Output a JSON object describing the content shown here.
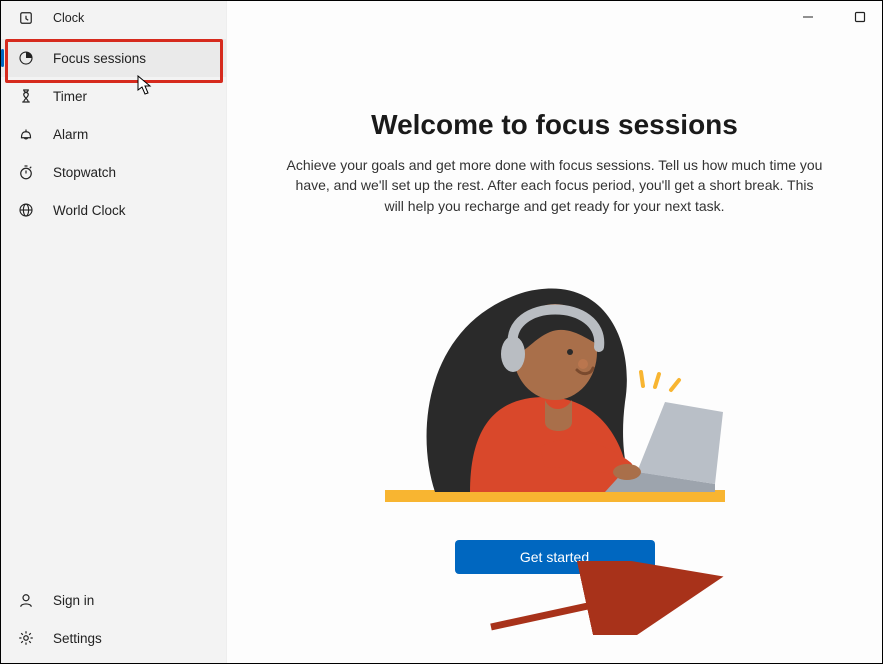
{
  "app": {
    "title": "Clock"
  },
  "sidebar": {
    "items": [
      {
        "label": "Focus sessions"
      },
      {
        "label": "Timer"
      },
      {
        "label": "Alarm"
      },
      {
        "label": "Stopwatch"
      },
      {
        "label": "World Clock"
      }
    ],
    "bottom": {
      "signin": "Sign in",
      "settings": "Settings"
    }
  },
  "main": {
    "headline": "Welcome to focus sessions",
    "description": "Achieve your goals and get more done with focus sessions. Tell us how much time you have, and we'll set up the rest. After each focus period, you'll get a short break. This will help you recharge and get ready for your next task.",
    "cta": "Get started"
  },
  "colors": {
    "accent": "#0067c0",
    "annotation": "#a8321a"
  }
}
